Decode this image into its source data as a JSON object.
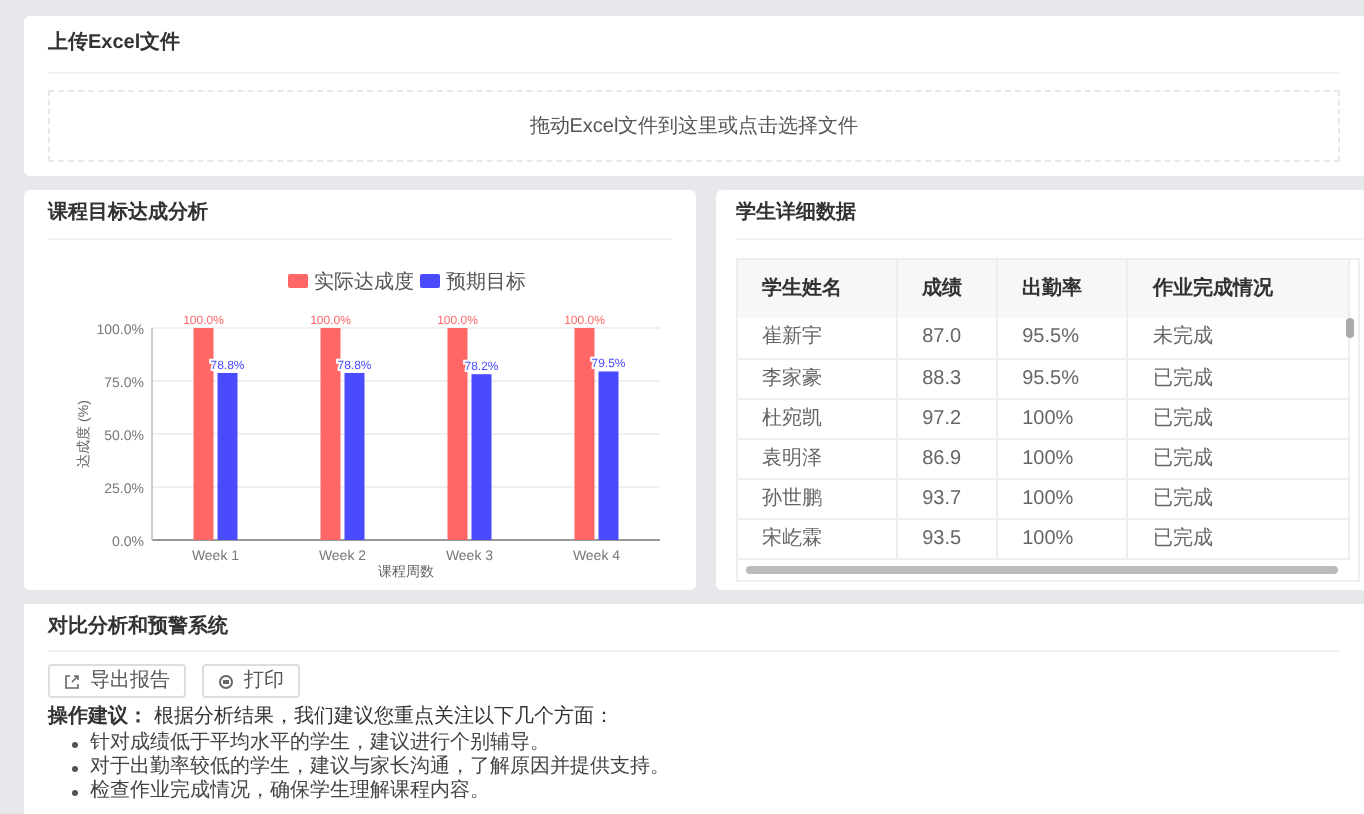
{
  "upload": {
    "title": "上传Excel文件",
    "dropzone_text": "拖动Excel文件到这里或点击选择文件"
  },
  "chart_panel": {
    "title": "课程目标达成分析",
    "chart_data": {
      "type": "bar",
      "xlabel": "课程周数",
      "ylabel": "达成度 (%)",
      "categories": [
        "Week 1",
        "Week 2",
        "Week 3",
        "Week 4"
      ],
      "series": [
        {
          "name": "实际达成度",
          "color": "#ff6666",
          "values": [
            100.0,
            100.0,
            100.0,
            100.0
          ]
        },
        {
          "name": "预期目标",
          "color": "#4a4aff",
          "values": [
            78.8,
            78.8,
            78.2,
            79.5
          ]
        }
      ],
      "ylim": [
        0,
        100
      ],
      "yticks": [
        {
          "value": 0,
          "label": "0.0%"
        },
        {
          "value": 25,
          "label": "25.0%"
        },
        {
          "value": 50,
          "label": "50.0%"
        },
        {
          "value": 75,
          "label": "75.0%"
        },
        {
          "value": 100,
          "label": "100.0%"
        }
      ],
      "value_labels": [
        [
          "100.0%",
          "100.0%",
          "100.0%",
          "100.0%"
        ],
        [
          "78.8%",
          "78.8%",
          "78.2%",
          "79.5%"
        ]
      ],
      "grid": true,
      "legend": true
    }
  },
  "table_panel": {
    "title": "学生详细数据",
    "columns": [
      "学生姓名",
      "成绩",
      "出勤率",
      "作业完成情况"
    ],
    "rows": [
      [
        "崔新宇",
        "87.0",
        "95.5%",
        "未完成"
      ],
      [
        "李家豪",
        "88.3",
        "95.5%",
        "已完成"
      ],
      [
        "杜宛凯",
        "97.2",
        "100%",
        "已完成"
      ],
      [
        "袁明泽",
        "86.9",
        "100%",
        "已完成"
      ],
      [
        "孙世鹏",
        "93.7",
        "100%",
        "已完成"
      ],
      [
        "宋屹霖",
        "93.5",
        "100%",
        "已完成"
      ]
    ]
  },
  "report_panel": {
    "title": "对比分析和预警系统",
    "buttons": [
      {
        "kind": "export",
        "label": "导出报告"
      },
      {
        "kind": "print",
        "label": "打印"
      }
    ],
    "advice": "**操作建议：** 根据分析结果，我们建议您重点关注以下几个方面：",
    "bullets": [
      "针对成绩低于平均水平的学生，建议进行个别辅导。",
      "对于出勤率较低的学生，建议与家长沟通，了解原因并提供支持。",
      "检查作业完成情况，确保学生理解课程内容。"
    ]
  }
}
